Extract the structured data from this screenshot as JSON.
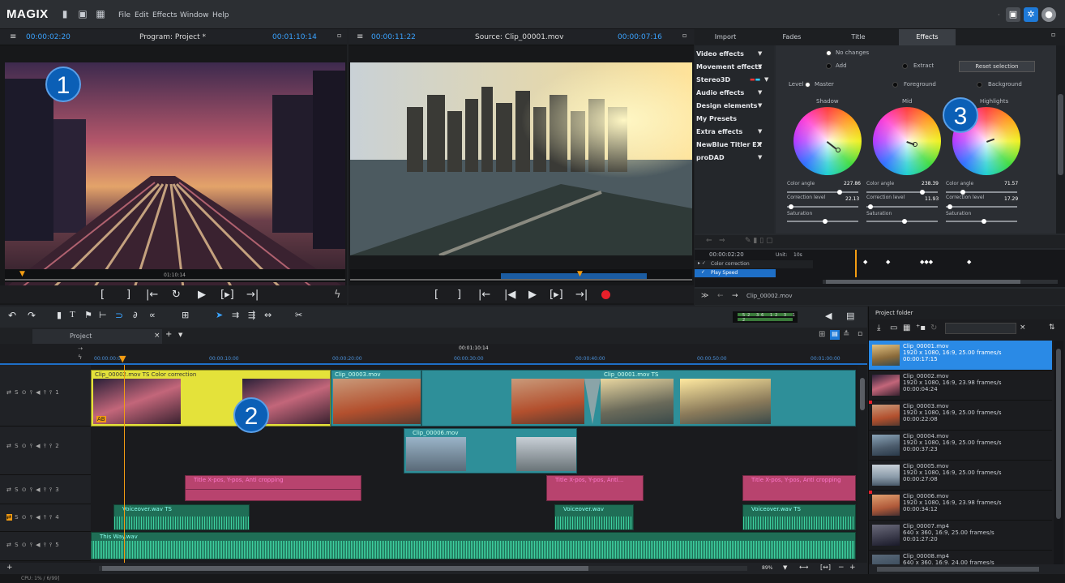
{
  "app": {
    "logo": "MAGIX",
    "menu": [
      "File",
      "Edit",
      "Effects",
      "Window",
      "Help"
    ]
  },
  "program_monitor": {
    "timecode_left": "00:00:02:20",
    "title": "Program: Project *",
    "timecode_right": "00:01:10:14",
    "scrub_time": "01:10:14"
  },
  "source_monitor": {
    "timecode_left": "00:00:11:22",
    "title": "Source: Clip_00001.mov",
    "timecode_right": "00:00:07:16"
  },
  "badges": [
    "1",
    "2",
    "3"
  ],
  "fx_panel": {
    "tabs": [
      "Import",
      "Fades",
      "Title",
      "Effects"
    ],
    "active_tab": "Effects",
    "categories": [
      "Video effects",
      "Movement effects",
      "Stereo3D",
      "Audio effects",
      "Design elements",
      "My Presets",
      "Extra effects",
      "NewBlue Titler EX",
      "proDAD"
    ],
    "options": {
      "no_changes": "No changes",
      "add": "Add",
      "extract": "Extract",
      "reset": "Reset selection"
    },
    "level_label": "Level",
    "levels": [
      "Master",
      "Foreground",
      "Background"
    ],
    "wheels": [
      {
        "name": "Shadow",
        "color_angle": "227.86",
        "correction_level": "22.13"
      },
      {
        "name": "Mid",
        "color_angle": "238.39",
        "correction_level": "11.93"
      },
      {
        "name": "Highlights",
        "color_angle": "71.57",
        "correction_level": "17.29"
      }
    ],
    "labels": {
      "color_angle": "Color angle",
      "correction_level": "Correction level",
      "saturation": "Saturation"
    },
    "keyframe": {
      "time": "00:00:02:20",
      "unit_label": "Unit:",
      "unit_value": "10s",
      "rows": [
        "Color correction",
        "Play Speed"
      ]
    },
    "clip_nav": "Clip_00002.mov"
  },
  "timeline": {
    "tab": "Project",
    "ruler_center": "00:01:10:14",
    "ruler_ticks": [
      "00:00:00:00",
      "00:00:10:00",
      "00:00:20:00",
      "00:00:30:00",
      "00:00:40:00",
      "00:00:50:00",
      "00:01:00:00"
    ],
    "tracks": [
      "1",
      "2",
      "3",
      "4",
      "5"
    ],
    "clips": {
      "t1a": "Clip_00002.mov  TS  Color correction",
      "t1b": "Clip_00003.mov",
      "t1c": "Clip_00001.mov  TS",
      "t2a": "Clip_00006.mov",
      "t3a": "Title   X-pos, Y-pos, Anti cropping",
      "t3b": "Title   X-pos, Y-pos, Anti...",
      "t3c": "Title   X-pos, Y-pos, Anti cropping",
      "t4a": "Voiceover.wav  TS",
      "t4b": "Voiceover.wav",
      "t4c": "Voiceover.wav  TS",
      "t5a": "This Way.wav"
    },
    "zoom": "89%",
    "meter_nums": [
      "52",
      "36",
      "12",
      "3",
      "1",
      "2"
    ]
  },
  "project_folder": {
    "title": "Project folder",
    "items": [
      {
        "name": "Clip_00001.mov",
        "info": "1920 x 1080, 16:9, 25.00 frames/s",
        "dur": "00:00:17:15"
      },
      {
        "name": "Clip_00002.mov",
        "info": "1920 x 1080, 16:9, 23.98 frames/s",
        "dur": "00:00:04:24"
      },
      {
        "name": "Clip_00003.mov",
        "info": "1920 x 1080, 16:9, 25.00 frames/s",
        "dur": "00:00:22:08"
      },
      {
        "name": "Clip_00004.mov",
        "info": "1920 x 1080, 16:9, 25.00 frames/s",
        "dur": "00:00:37:23"
      },
      {
        "name": "Clip_00005.mov",
        "info": "1920 x 1080, 16:9, 25.00 frames/s",
        "dur": "00:00:27:08"
      },
      {
        "name": "Clip_00006.mov",
        "info": "1920 x 1080, 16:9, 23.98 frames/s",
        "dur": "00:00:34:12"
      },
      {
        "name": "Clip_00007.mp4",
        "info": "640 x 360, 16:9, 25.00 frames/s",
        "dur": "00:01:27:20"
      },
      {
        "name": "Clip_00008.mp4",
        "info": "640 x 360, 16:9, 24.00 frames/s",
        "dur": ""
      }
    ]
  },
  "status": {
    "text": "CPU: 1% / 6/99]"
  },
  "colors": {
    "accent": "#3aa3ff",
    "selected": "#2a8ae6",
    "clip_yellow": "#e4e23a",
    "clip_teal": "#2e8f99",
    "clip_pink": "#b8436e",
    "clip_green": "#2aa37c"
  }
}
